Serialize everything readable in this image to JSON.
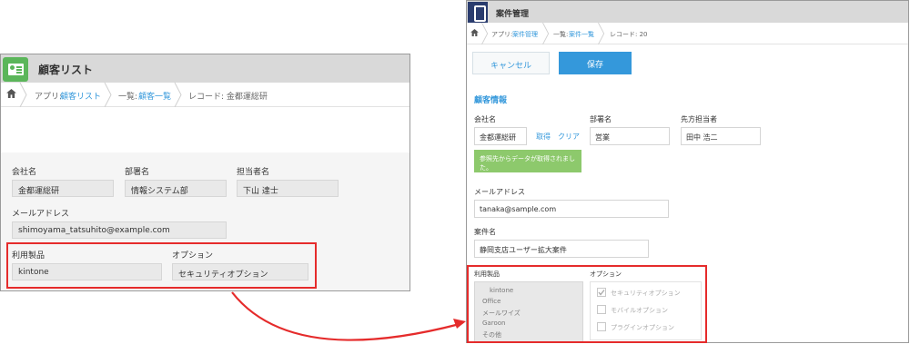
{
  "left": {
    "app_title": "顧客リスト",
    "breadcrumb": {
      "app_prefix": "アプリ:",
      "app_link": "顧客リスト",
      "list_prefix": "一覧:",
      "list_link": "顧客一覧",
      "record": "レコード: 金都運総研"
    },
    "fields": {
      "company": {
        "label": "会社名",
        "value": "金都運総研"
      },
      "dept": {
        "label": "部署名",
        "value": "情報システム部"
      },
      "person": {
        "label": "担当者名",
        "value": "下山 達士"
      },
      "email": {
        "label": "メールアドレス",
        "value": "shimoyama_tatsuhito@example.com"
      },
      "product": {
        "label": "利用製品",
        "value": "kintone"
      },
      "option": {
        "label": "オプション",
        "value": "セキュリティオプション"
      }
    }
  },
  "right": {
    "app_title": "案件管理",
    "breadcrumb": {
      "app_prefix": "アプリ:",
      "app_link": "案件管理",
      "list_prefix": "一覧:",
      "list_link": "案件一覧",
      "record": "レコード: 20"
    },
    "buttons": {
      "cancel": "キャンセル",
      "save": "保存"
    },
    "section_title": "顧客情報",
    "fields": {
      "company": {
        "label": "会社名",
        "value": "金都運総研",
        "fetch": "取得",
        "clear": "クリア"
      },
      "dept": {
        "label": "部署名",
        "value": "営業"
      },
      "owner": {
        "label": "先方担当者",
        "value": "田中 浩二"
      },
      "email": {
        "label": "メールアドレス",
        "value": "tanaka@sample.com"
      },
      "deal": {
        "label": "案件名",
        "value": "静岡支店ユーザー拡大案件"
      },
      "product": {
        "label": "利用製品",
        "options": [
          "kintone",
          "Office",
          "メールワイズ",
          "Garoon",
          "その他"
        ],
        "selected": "kintone"
      },
      "option": {
        "label": "オプション",
        "checkboxes": [
          {
            "label": "セキュリティオプション",
            "checked": true
          },
          {
            "label": "モバイルオプション",
            "checked": false
          },
          {
            "label": "プラグインオプション",
            "checked": false
          }
        ]
      }
    },
    "notice": "参照先からデータが取得されました。"
  },
  "colors": {
    "highlight": "#e52b2b",
    "link": "#3498db",
    "notice": "#8dc96c",
    "header": "#d9d9d9"
  }
}
